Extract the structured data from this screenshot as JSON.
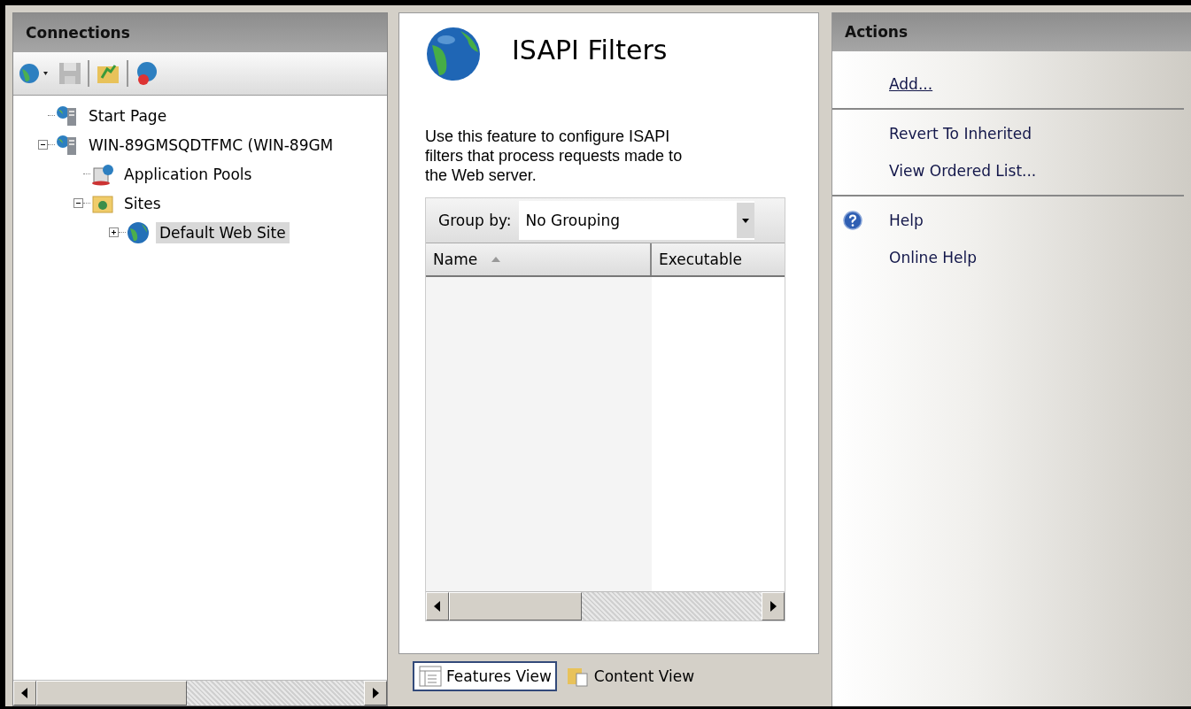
{
  "connections": {
    "title": "Connections",
    "tree": [
      {
        "label": "Start Page",
        "selected": false
      },
      {
        "label": "WIN-89GMSQDTFMC (WIN-89GM",
        "selected": false,
        "expanded": true,
        "children": [
          {
            "label": "Application Pools",
            "selected": false
          },
          {
            "label": "Sites",
            "selected": false,
            "expanded": true,
            "children": [
              {
                "label": "Default Web Site",
                "selected": true,
                "expanded": false
              }
            ]
          }
        ]
      }
    ]
  },
  "feature": {
    "title": "ISAPI Filters",
    "description": "Use this feature to configure ISAPI filters that process requests made to the Web server.",
    "group_by": {
      "label": "Group by:",
      "value": "No Grouping"
    },
    "columns": [
      {
        "label": "Name",
        "sorted": true
      },
      {
        "label": "Executable",
        "sorted": false
      }
    ],
    "views": [
      {
        "label": "Features View",
        "selected": true
      },
      {
        "label": "Content View",
        "selected": false
      }
    ]
  },
  "actions": {
    "title": "Actions",
    "sections": [
      {
        "items": [
          {
            "label": "Add...",
            "kind": "plain",
            "underlined": true
          }
        ]
      },
      {
        "items": [
          {
            "label": "Revert To Inherited",
            "kind": "plain",
            "underlined": false
          },
          {
            "label": "View Ordered List...",
            "kind": "plain",
            "underlined": false
          }
        ]
      },
      {
        "items": [
          {
            "label": "Help",
            "kind": "help",
            "underlined": false
          },
          {
            "label": "Online Help",
            "kind": "plain",
            "underlined": false
          }
        ]
      }
    ]
  }
}
